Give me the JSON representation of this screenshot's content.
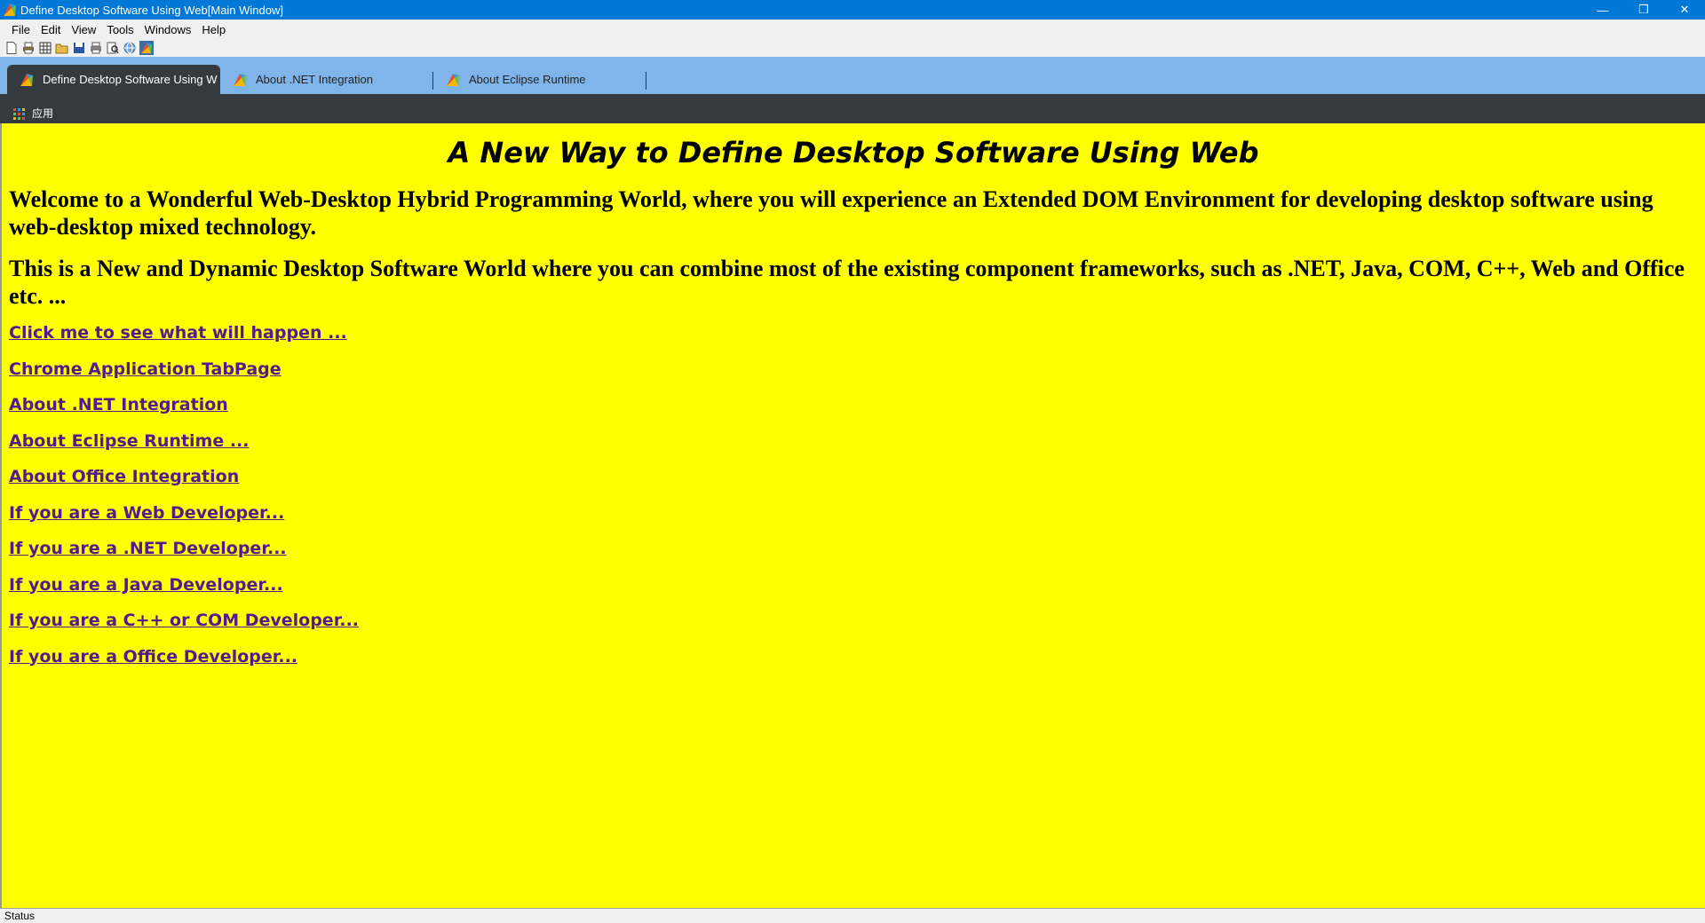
{
  "window": {
    "title": "Define Desktop Software Using Web[Main Window]",
    "minimize_glyph": "—",
    "restore_glyph": "❐",
    "close_glyph": "✕"
  },
  "menu": {
    "items": [
      "File",
      "Edit",
      "View",
      "Tools",
      "Windows",
      "Help"
    ]
  },
  "toolbar": {
    "icons": [
      "new-document-icon",
      "print-icon",
      "grid-icon",
      "open-folder-icon",
      "save-icon",
      "printer-icon",
      "print-preview-icon",
      "globe-icon",
      "app-icon"
    ]
  },
  "tabs": [
    {
      "label": "Define Desktop Software Using W",
      "active": true,
      "icon": "app-icon"
    },
    {
      "label": "About .NET Integration",
      "active": false,
      "icon": "app-icon"
    },
    {
      "label": "About Eclipse Runtime",
      "active": false,
      "icon": "app-icon"
    }
  ],
  "bookmarks": {
    "apps_label": "应用",
    "apps_icon": "apps-grid-icon"
  },
  "page": {
    "background": "#ffff00",
    "title": "A New Way to Define Desktop Software Using Web",
    "intro_1": "Welcome to a Wonderful Web-Desktop Hybrid Programming World, where you will experience an Extended DOM Environment for developing desktop software using web-desktop mixed technology.",
    "intro_2": "This is a New and Dynamic Desktop Software World where you can combine most of the existing component frameworks, such as .NET, Java, COM, C++, Web and Office etc. ...",
    "links": [
      "Click me to see what will happen ...",
      "Chrome Application TabPage",
      "About .NET Integration",
      "About Eclipse Runtime ...",
      "About Office Integration",
      "If you are a Web Developer...",
      "If you are a .NET Developer...",
      "If you are a Java Developer...",
      "If you are a C++ or COM Developer...",
      "If you are a Office Developer..."
    ]
  },
  "status": {
    "text": "Status"
  },
  "colors": {
    "titlebar": "#0078d7",
    "tabstrip": "#7fb5ea",
    "active_tab": "#353a3f",
    "link": "#551a8b"
  }
}
